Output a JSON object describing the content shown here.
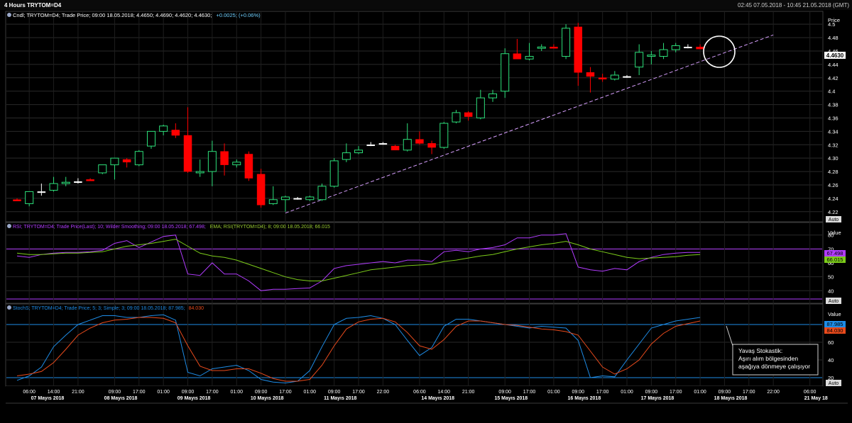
{
  "header": {
    "title": "4 Hours TRYTOM=D4",
    "range": "02:45 07.05.2018 - 10:45 21.05.2018 (GMT)"
  },
  "price_panel": {
    "legend": "Cndl; TRYTOM=D4; Trade Price; 09:00 18.05.2018; 4.4650; 4.4690; 4.4620; 4.4630;",
    "legend_change": "+0.0025; (+0.06%)",
    "axis_title": "Price",
    "last_label": "4.4630",
    "auto_label": "Auto"
  },
  "rsi_panel": {
    "legend_rsi": "RSI; TRYTOM=D4; Trade Price(Last); 10; Wilder Smoothing; 09:00 18.05.2018; 67.498;",
    "legend_ema": "EMA; RSI(TRYTOM=D4); 8; 09:00 18.05.2018; 66.015",
    "axis_title": "Value",
    "rsi_last_label": "67.498",
    "ema_last_label": "66.015",
    "auto_label": "Auto"
  },
  "stoch_panel": {
    "legend_main": "StochS; TRYTOM=D4; Trade Price; 5; 3; Simple; 3; 09:00 18.05.2018; 87.985;",
    "legend_second": "84.030",
    "axis_title": "Value",
    "k_last_label": "87.985",
    "d_last_label": "84.030",
    "auto_label": "Auto"
  },
  "annotation": {
    "line1": "Yavaş Stokastik:",
    "line2": "Aşırı alım bölgesinden",
    "line3": "aşağıya dönmeye çalışıyor"
  },
  "colors": {
    "up": "#2de07a",
    "down": "#ff0000",
    "doji": "#ffffff",
    "rsi": "#b23cff",
    "ema": "#7ccc1a",
    "stoch_k": "#1e8ce6",
    "stoch_d": "#e84a1c",
    "level": "#1e8ce6",
    "rsi_level": "#b23cff",
    "trendline": "#d8a0ff",
    "last_price_bg": "#ffffff"
  },
  "chart_data": [
    {
      "type": "candlestick",
      "title": "4 Hours TRYTOM=D4",
      "ylabel": "Price",
      "ylim": [
        4.206,
        4.515
      ],
      "yticks": [
        4.22,
        4.24,
        4.26,
        4.28,
        4.3,
        4.32,
        4.34,
        4.36,
        4.38,
        4.4,
        4.42,
        4.44,
        4.46,
        4.48,
        4.5
      ],
      "xticks": [
        {
          "i": 1,
          "label": "06:00"
        },
        {
          "i": 3,
          "label": "14:00"
        },
        {
          "i": 5,
          "label": "21:00"
        },
        {
          "i": 8,
          "label": "09:00"
        },
        {
          "i": 10,
          "label": "17:00"
        },
        {
          "i": 12,
          "label": "01:00"
        },
        {
          "i": 14,
          "label": "09:00"
        },
        {
          "i": 16,
          "label": "17:00"
        },
        {
          "i": 18,
          "label": "01:00"
        },
        {
          "i": 20,
          "label": "09:00"
        },
        {
          "i": 22,
          "label": "17:00"
        },
        {
          "i": 24,
          "label": "01:00"
        },
        {
          "i": 26,
          "label": "09:00"
        },
        {
          "i": 28,
          "label": "17:00"
        },
        {
          "i": 30,
          "label": "22:00"
        },
        {
          "i": 33,
          "label": "06:00"
        },
        {
          "i": 35,
          "label": "14:00"
        },
        {
          "i": 37,
          "label": "21:00"
        },
        {
          "i": 40,
          "label": "09:00"
        },
        {
          "i": 42,
          "label": "17:00"
        },
        {
          "i": 44,
          "label": "01:00"
        },
        {
          "i": 46,
          "label": "09:00"
        },
        {
          "i": 48,
          "label": "17:00"
        },
        {
          "i": 50,
          "label": "01:00"
        },
        {
          "i": 52,
          "label": "09:00"
        },
        {
          "i": 54,
          "label": "17:00"
        },
        {
          "i": 56,
          "label": "01:00"
        },
        {
          "i": 58,
          "label": "09:00"
        },
        {
          "i": 60,
          "label": "17:00"
        },
        {
          "i": 62,
          "label": "22:00"
        },
        {
          "i": 65,
          "label": "06:00"
        }
      ],
      "days": [
        {
          "i": 2.5,
          "label": "07 Mayıs 2018"
        },
        {
          "i": 8.5,
          "label": "08 Mayıs 2018"
        },
        {
          "i": 14.5,
          "label": "09 Mayıs 2018"
        },
        {
          "i": 20.5,
          "label": "10 Mayıs 2018"
        },
        {
          "i": 26.5,
          "label": "11 Mayıs 2018"
        },
        {
          "i": 34.5,
          "label": "14 Mayıs 2018"
        },
        {
          "i": 40.5,
          "label": "15 Mayıs 2018"
        },
        {
          "i": 46.5,
          "label": "16 Mayıs 2018"
        },
        {
          "i": 52.5,
          "label": "17 Mayıs 2018"
        },
        {
          "i": 58.5,
          "label": "18 Mayıs 2018"
        },
        {
          "i": 65.5,
          "label": "21 May 18"
        }
      ],
      "candles": [
        [
          4.238,
          4.24,
          4.236,
          4.236
        ],
        [
          4.232,
          4.25,
          4.228,
          4.25
        ],
        [
          4.25,
          4.262,
          4.244,
          4.25
        ],
        [
          4.252,
          4.272,
          4.25,
          4.262
        ],
        [
          4.262,
          4.272,
          4.258,
          4.264
        ],
        [
          4.265,
          4.27,
          4.262,
          4.265
        ],
        [
          4.268,
          4.27,
          4.266,
          4.266
        ],
        [
          4.278,
          4.29,
          4.276,
          4.29
        ],
        [
          4.29,
          4.3,
          4.268,
          4.3
        ],
        [
          4.298,
          4.3,
          4.286,
          4.294
        ],
        [
          4.29,
          4.312,
          4.288,
          4.31
        ],
        [
          4.318,
          4.34,
          4.314,
          4.34
        ],
        [
          4.34,
          4.35,
          4.334,
          4.348
        ],
        [
          4.342,
          4.352,
          4.33,
          4.334
        ],
        [
          4.334,
          4.376,
          4.278,
          4.28
        ],
        [
          4.278,
          4.298,
          4.272,
          4.28
        ],
        [
          4.28,
          4.326,
          4.258,
          4.31
        ],
        [
          4.31,
          4.322,
          4.274,
          4.29
        ],
        [
          4.29,
          4.298,
          4.286,
          4.294
        ],
        [
          4.306,
          4.31,
          4.266,
          4.27
        ],
        [
          4.276,
          4.284,
          4.226,
          4.23
        ],
        [
          4.232,
          4.258,
          4.23,
          4.238
        ],
        [
          4.238,
          4.244,
          4.22,
          4.242
        ],
        [
          4.24,
          4.242,
          4.238,
          4.24
        ],
        [
          4.238,
          4.244,
          4.236,
          4.242
        ],
        [
          4.238,
          4.262,
          4.236,
          4.258
        ],
        [
          4.258,
          4.3,
          4.256,
          4.296
        ],
        [
          4.298,
          4.322,
          4.294,
          4.308
        ],
        [
          4.308,
          4.318,
          4.306,
          4.312
        ],
        [
          4.32,
          4.324,
          4.318,
          4.32
        ],
        [
          4.322,
          4.324,
          4.32,
          4.322
        ],
        [
          4.318,
          4.32,
          4.312,
          4.312
        ],
        [
          4.312,
          4.352,
          4.31,
          4.328
        ],
        [
          4.328,
          4.34,
          4.32,
          4.322
        ],
        [
          4.322,
          4.326,
          4.306,
          4.316
        ],
        [
          4.316,
          4.354,
          4.314,
          4.352
        ],
        [
          4.354,
          4.372,
          4.352,
          4.368
        ],
        [
          4.368,
          4.37,
          4.356,
          4.362
        ],
        [
          4.36,
          4.402,
          4.358,
          4.39
        ],
        [
          4.39,
          4.402,
          4.384,
          4.396
        ],
        [
          4.4,
          4.464,
          4.39,
          4.456
        ],
        [
          4.456,
          4.478,
          4.448,
          4.448
        ],
        [
          4.448,
          4.472,
          4.446,
          4.452
        ],
        [
          4.464,
          4.47,
          4.46,
          4.466
        ],
        [
          4.466,
          4.47,
          4.464,
          4.464
        ],
        [
          4.452,
          4.5,
          4.448,
          4.494
        ],
        [
          4.496,
          4.502,
          4.408,
          4.428
        ],
        [
          4.428,
          4.436,
          4.398,
          4.422
        ],
        [
          4.42,
          4.426,
          4.414,
          4.418
        ],
        [
          4.418,
          4.43,
          4.416,
          4.424
        ],
        [
          4.422,
          4.424,
          4.42,
          4.422
        ],
        [
          4.436,
          4.47,
          4.424,
          4.458
        ],
        [
          4.452,
          4.46,
          4.44,
          4.454
        ],
        [
          4.452,
          4.472,
          4.448,
          4.462
        ],
        [
          4.462,
          4.472,
          4.458,
          4.468
        ],
        [
          4.466,
          4.47,
          4.464,
          4.466
        ],
        [
          4.466,
          4.47,
          4.464,
          4.463
        ]
      ],
      "trendline": [
        [
          22,
          4.218
        ],
        [
          62,
          4.484
        ]
      ],
      "last_price": 4.463
    },
    {
      "type": "line",
      "ylabel": "Value",
      "ylim": [
        32,
        87
      ],
      "yticks": [
        40,
        50,
        60,
        70,
        80
      ],
      "level": 70,
      "series": [
        {
          "name": "RSI",
          "values": [
            65,
            64,
            66,
            67,
            67.5,
            67.5,
            68,
            69,
            74,
            76,
            71,
            75,
            79,
            80,
            52,
            51,
            60,
            52,
            52,
            47,
            40,
            41,
            41,
            41.5,
            42,
            47,
            56,
            58,
            59,
            60,
            61,
            60,
            62,
            62,
            61,
            68,
            69,
            68,
            70,
            71,
            73,
            78,
            78,
            80,
            80,
            81,
            57,
            55,
            54,
            56,
            55,
            61,
            64,
            66,
            67,
            67.5,
            67.5
          ]
        },
        {
          "name": "EMA",
          "values": [
            67,
            66,
            66,
            66.5,
            67,
            67,
            67.5,
            68,
            70,
            72,
            73,
            74,
            75.5,
            77,
            72,
            67,
            65,
            64,
            62,
            59,
            56,
            53,
            50,
            48,
            47,
            47,
            49,
            51,
            53,
            55,
            56,
            57,
            58,
            58.5,
            59,
            61,
            62,
            63.5,
            65,
            66,
            68,
            70,
            71.5,
            73,
            74,
            75.5,
            73,
            70,
            68,
            66,
            64,
            63,
            63.5,
            64,
            64.5,
            65.5,
            66
          ]
        }
      ]
    },
    {
      "type": "line",
      "ylabel": "Value",
      "ylim": [
        12,
        100
      ],
      "yticks": [
        20,
        40,
        60,
        80
      ],
      "levels": [
        20,
        80
      ],
      "series": [
        {
          "name": "StochS",
          "values": [
            17,
            22,
            32,
            55,
            68,
            80,
            85,
            90,
            90,
            88,
            88,
            90,
            91,
            85,
            26,
            22,
            30,
            32,
            34,
            28,
            18,
            15,
            14,
            16,
            28,
            55,
            80,
            87,
            88,
            90,
            87,
            80,
            62,
            45,
            54,
            78,
            86,
            86,
            84,
            82,
            80,
            78,
            76,
            78,
            77,
            76,
            62,
            20,
            22,
            21,
            40,
            58,
            76,
            80,
            84,
            86,
            88
          ]
        },
        {
          "name": "84.030",
          "values": [
            22,
            24,
            27,
            37,
            52,
            68,
            76,
            82,
            85,
            86,
            88,
            88,
            87,
            82,
            56,
            33,
            28,
            28,
            30,
            30,
            25,
            19,
            16,
            16,
            18,
            34,
            56,
            75,
            83,
            86,
            87,
            83,
            71,
            56,
            52,
            63,
            78,
            84,
            84,
            82,
            80,
            79,
            77,
            75,
            74,
            72,
            68,
            50,
            32,
            24,
            30,
            40,
            58,
            70,
            78,
            81,
            84
          ]
        }
      ]
    }
  ]
}
